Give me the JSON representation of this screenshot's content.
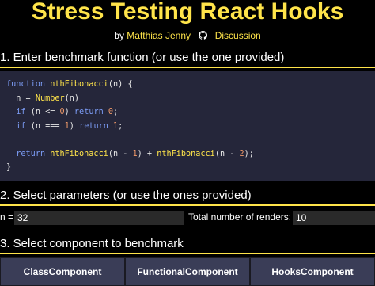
{
  "header": {
    "title": "Stress Testing React Hooks",
    "by": "by",
    "author": "Matthias Jenny",
    "discussion": "Discussion"
  },
  "sections": {
    "s1": "1. Enter benchmark function (or use the one provided)",
    "s2": "2. Select parameters (or use the ones provided)",
    "s3": "3. Select component to benchmark"
  },
  "code": {
    "lines": [
      "function nthFibonacci(n) {",
      "  n = Number(n)",
      "  if (n <= 0) return 0;",
      "  if (n === 1) return 1;",
      "",
      "  return nthFibonacci(n - 1) + nthFibonacci(n - 2);",
      "}"
    ]
  },
  "params": {
    "n_label": "n =",
    "n_value": "32",
    "renders_label": "Total number of renders:",
    "renders_value": "10"
  },
  "buttons": {
    "class": "ClassComponent",
    "functional": "FunctionalComponent",
    "hooks": "HooksComponent"
  },
  "colors": {
    "accent": "#ffe44a",
    "code_bg": "#25263a",
    "button_bg": "#3a3d57"
  }
}
